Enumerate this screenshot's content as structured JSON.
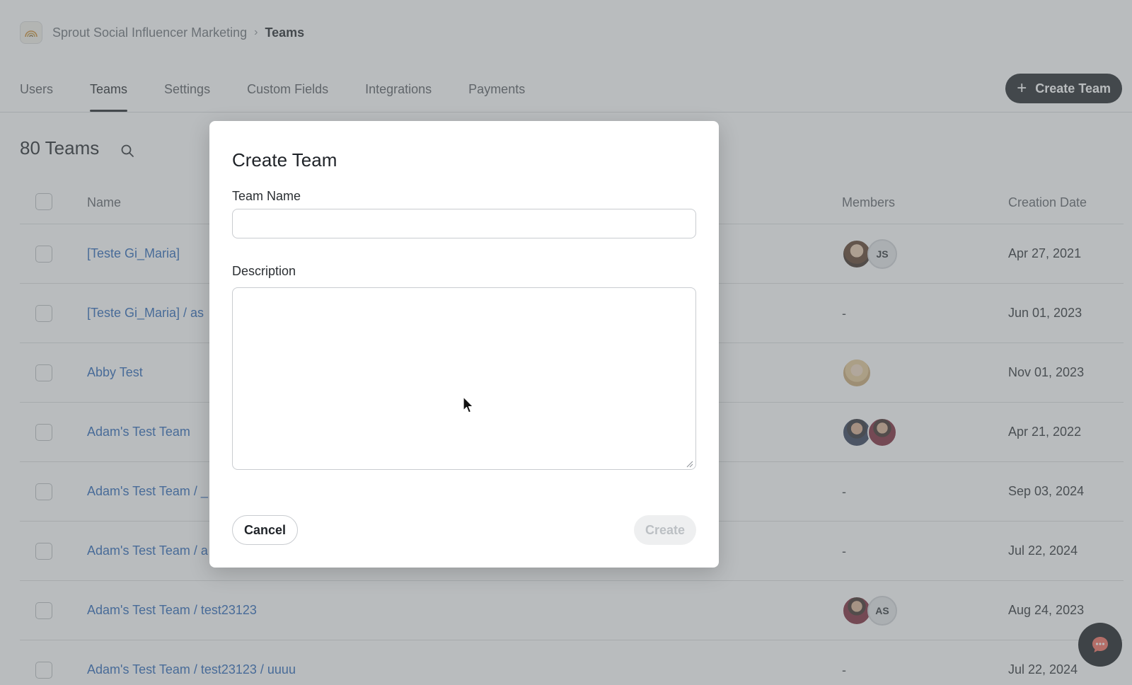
{
  "breadcrumb": {
    "org": "Sprout Social Influencer Marketing",
    "separator": "›",
    "current": "Teams"
  },
  "tabs": [
    {
      "label": "Users",
      "active": false
    },
    {
      "label": "Teams",
      "active": true
    },
    {
      "label": "Settings",
      "active": false
    },
    {
      "label": "Custom Fields",
      "active": false
    },
    {
      "label": "Integrations",
      "active": false
    },
    {
      "label": "Payments",
      "active": false
    }
  ],
  "create_team_button": {
    "icon": "plus-icon",
    "label": "Create Team"
  },
  "teams_count": "80 Teams",
  "table": {
    "headers": {
      "name": "Name",
      "members": "Members",
      "creation_date": "Creation Date"
    },
    "rows": [
      {
        "name": "[Teste Gi_Maria]",
        "members": [
          "photo",
          "JS"
        ],
        "date": "Apr 27, 2021"
      },
      {
        "name": "[Teste Gi_Maria] / as",
        "members": "-",
        "date": "Jun 01, 2023"
      },
      {
        "name": "Abby Test",
        "members": [
          "photo"
        ],
        "date": "Nov 01, 2023"
      },
      {
        "name": "Adam's Test Team",
        "members": [
          "photo",
          "photo"
        ],
        "date": "Apr 21, 2022"
      },
      {
        "name": "Adam's Test Team / _",
        "members": "-",
        "date": "Sep 03, 2024"
      },
      {
        "name": "Adam's Test Team / a",
        "members": "-",
        "date": "Jul 22, 2024"
      },
      {
        "name": "Adam's Test Team / test23123",
        "members": [
          "photo",
          "AS"
        ],
        "date": "Aug 24, 2023"
      },
      {
        "name": "Adam's Test Team / test23123 / uuuu",
        "members": "-",
        "date": "Jul 22, 2024"
      }
    ]
  },
  "modal": {
    "title": "Create Team",
    "team_name_label": "Team Name",
    "team_name_value": "",
    "description_label": "Description",
    "description_value": "",
    "cancel_label": "Cancel",
    "create_label": "Create"
  },
  "colors": {
    "link": "#2764b6",
    "primary_button": "#1d2125",
    "overlay": "rgba(108,116,120,0.48)"
  },
  "chat_button": {
    "icon": "chat-bubble-icon"
  }
}
